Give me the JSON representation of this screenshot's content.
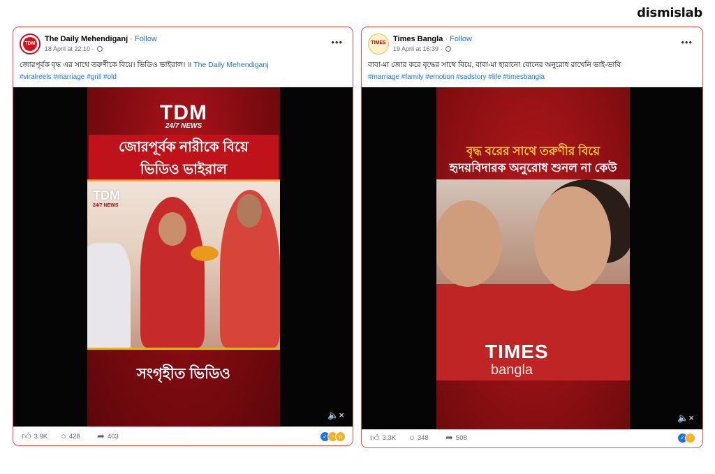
{
  "brand": "dismislab",
  "posts": [
    {
      "page_name": "The Daily Mehendiganj",
      "separator": " · ",
      "follow": "Follow",
      "avatar_text": "TDM",
      "timestamp": "18 April at 22:10 · ",
      "caption": "জোরপূর্বক বৃদ্ধ এর সাথে তরুণীকে বিয়ে। ভিডিও ভাইরাল। ॥ ",
      "caption_link": "The Daily Mehendiganj",
      "hashtags": "#viralreels #marriage #grill #old",
      "video": {
        "logo": "TDM",
        "logo_sub": "24/7 NEWS",
        "headline_1": "জোরপূর্বক নারীকে বিয়ে",
        "headline_2": "ভিডিও ভাইরাল",
        "watermark": "TDM",
        "watermark_sub": "24/7 NEWS",
        "bottom_caption": "সংগৃহীত ভিডিও"
      },
      "likes": "3.9K",
      "comments": "428",
      "shares": "403"
    },
    {
      "page_name": "Times Bangla",
      "separator": " · ",
      "follow": "Follow",
      "avatar_text": "TIMES",
      "timestamp": "19 April at 16:39 · ",
      "caption": "বাবা-মা জোর করে বৃদ্ধের সাথে বিয়ে, বাবা-মা হারানো বোনের অনুরোধ রাখেনি ভাই-ভাবি",
      "hashtags": "#marriage #family #emotion #sadstory #life #timesbangla",
      "video": {
        "title_1": "বৃদ্ধ বরের সাথে তরুণীর বিয়ে",
        "title_2": "হৃদয়বিদারক অনুরোধ শুনল না কেউ",
        "watermark_1": "TIMES",
        "watermark_2": "bangla"
      },
      "likes": "3.3K",
      "comments": "348",
      "shares": "508"
    }
  ],
  "icons": {
    "like": "like-icon",
    "comment": "comment-icon",
    "share": "share-icon",
    "more": "more-options-icon",
    "mute": "mute-icon",
    "globe": "globe-icon"
  },
  "colors": {
    "card_border": "#d9534f",
    "link_blue": "#1b74e4",
    "video_red": "#b0141a",
    "headline_yellow": "#f4c531"
  }
}
